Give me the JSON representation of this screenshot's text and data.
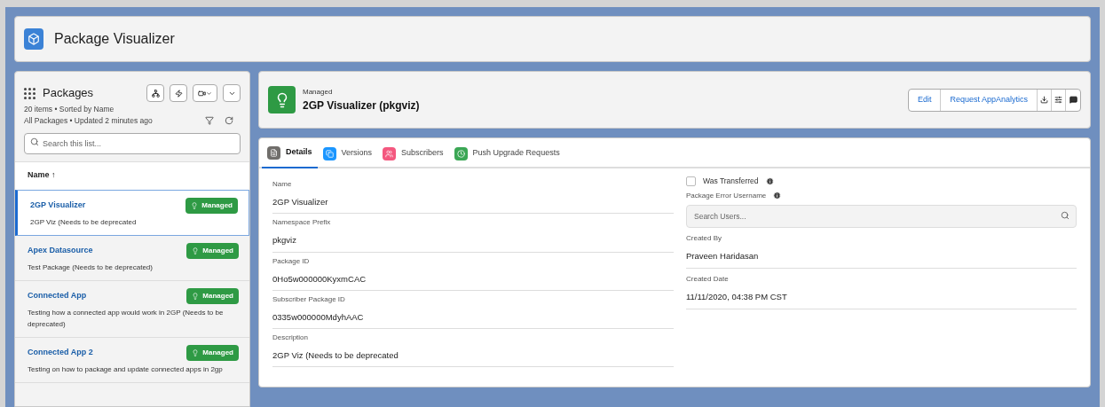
{
  "app": {
    "title": "Package Visualizer"
  },
  "list": {
    "title": "Packages",
    "meta_1": "20 items • Sorted by Name",
    "meta_2": "All Packages • Updated 2 minutes ago",
    "search": {
      "placeholder": "Search this list..."
    },
    "column": "Name",
    "sort_glyph": "↑",
    "items": [
      {
        "name": "2GP Visualizer",
        "description": "2GP Viz (Needs to be deprecated",
        "badge": "Managed",
        "selected": true
      },
      {
        "name": "Apex Datasource",
        "description": "Test Package (Needs to be deprecated)",
        "badge": "Managed",
        "selected": false
      },
      {
        "name": "Connected App",
        "description": "Testing how a connected app would work in 2GP (Needs to be deprecated)",
        "badge": "Managed",
        "selected": false
      },
      {
        "name": "Connected App 2",
        "description": "Testing on how to package and update connected apps in 2gp",
        "badge": "Managed",
        "selected": false
      }
    ]
  },
  "record": {
    "type": "Managed",
    "title": "2GP Visualizer (pkgviz)",
    "actions": [
      "Edit",
      "Request AppAnalytics"
    ]
  },
  "tabs": [
    {
      "label": "Details",
      "selected": true,
      "color": "#706e6b"
    },
    {
      "label": "Versions",
      "selected": false,
      "color": "#1b96ff"
    },
    {
      "label": "Subscribers",
      "selected": false,
      "color": "#f4587f"
    },
    {
      "label": "Push Upgrade Requests",
      "selected": false,
      "color": "#3ba755"
    }
  ],
  "details_left": [
    {
      "label": "Name",
      "value": "2GP Visualizer"
    },
    {
      "label": "Namespace Prefix",
      "value": "pkgviz"
    },
    {
      "label": "Package ID",
      "value": "0Ho5w000000KyxmCAC"
    },
    {
      "label": "Subscriber Package ID",
      "value": "0335w000000MdyhAAC"
    },
    {
      "label": "Description",
      "value": "2GP Viz (Needs to be deprecated"
    }
  ],
  "was_transferred": {
    "label": "Was Transferred",
    "checked": false
  },
  "error_username": {
    "label": "Package Error Username",
    "placeholder": "Search Users..."
  },
  "details_right": [
    {
      "label": "Created By",
      "value": "Praveen Haridasan"
    },
    {
      "label": "Created Date",
      "value": "11/11/2020, 04:38 PM CST"
    }
  ]
}
